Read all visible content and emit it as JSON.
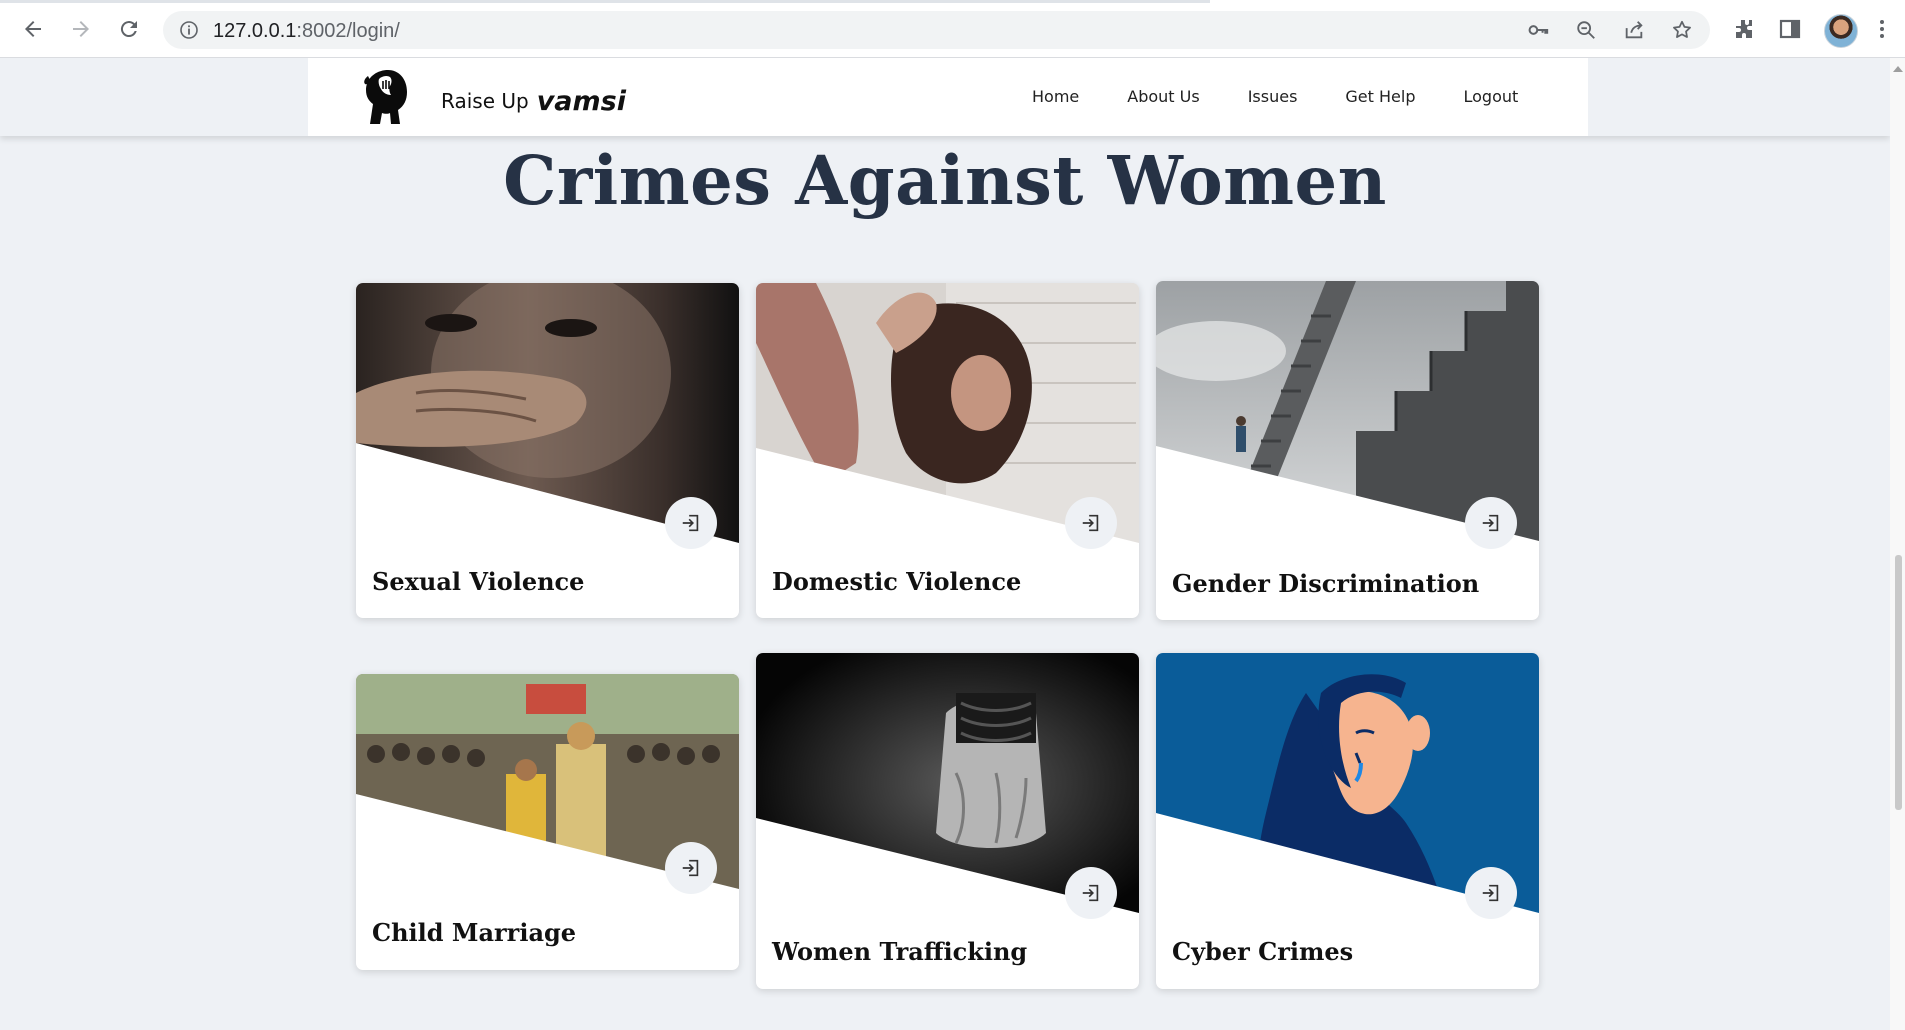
{
  "browser": {
    "url_host": "127.0.0.1",
    "url_path": ":8002/login/"
  },
  "header": {
    "brand": "Raise Up",
    "username": "vamsi",
    "nav": [
      "Home",
      "About Us",
      "Issues",
      "Get Help",
      "Logout"
    ]
  },
  "page": {
    "title": "Crimes Against Women"
  },
  "cards": [
    {
      "title": "Sexual Violence"
    },
    {
      "title": "Domestic Violence"
    },
    {
      "title": "Gender Discrimination"
    },
    {
      "title": "Child Marriage"
    },
    {
      "title": "Women Trafficking"
    },
    {
      "title": "Cyber Crimes"
    }
  ],
  "colors": {
    "page_background": "#eef1f5",
    "title_text": "#263245",
    "cyber_card_blue": "#0a5c99"
  }
}
